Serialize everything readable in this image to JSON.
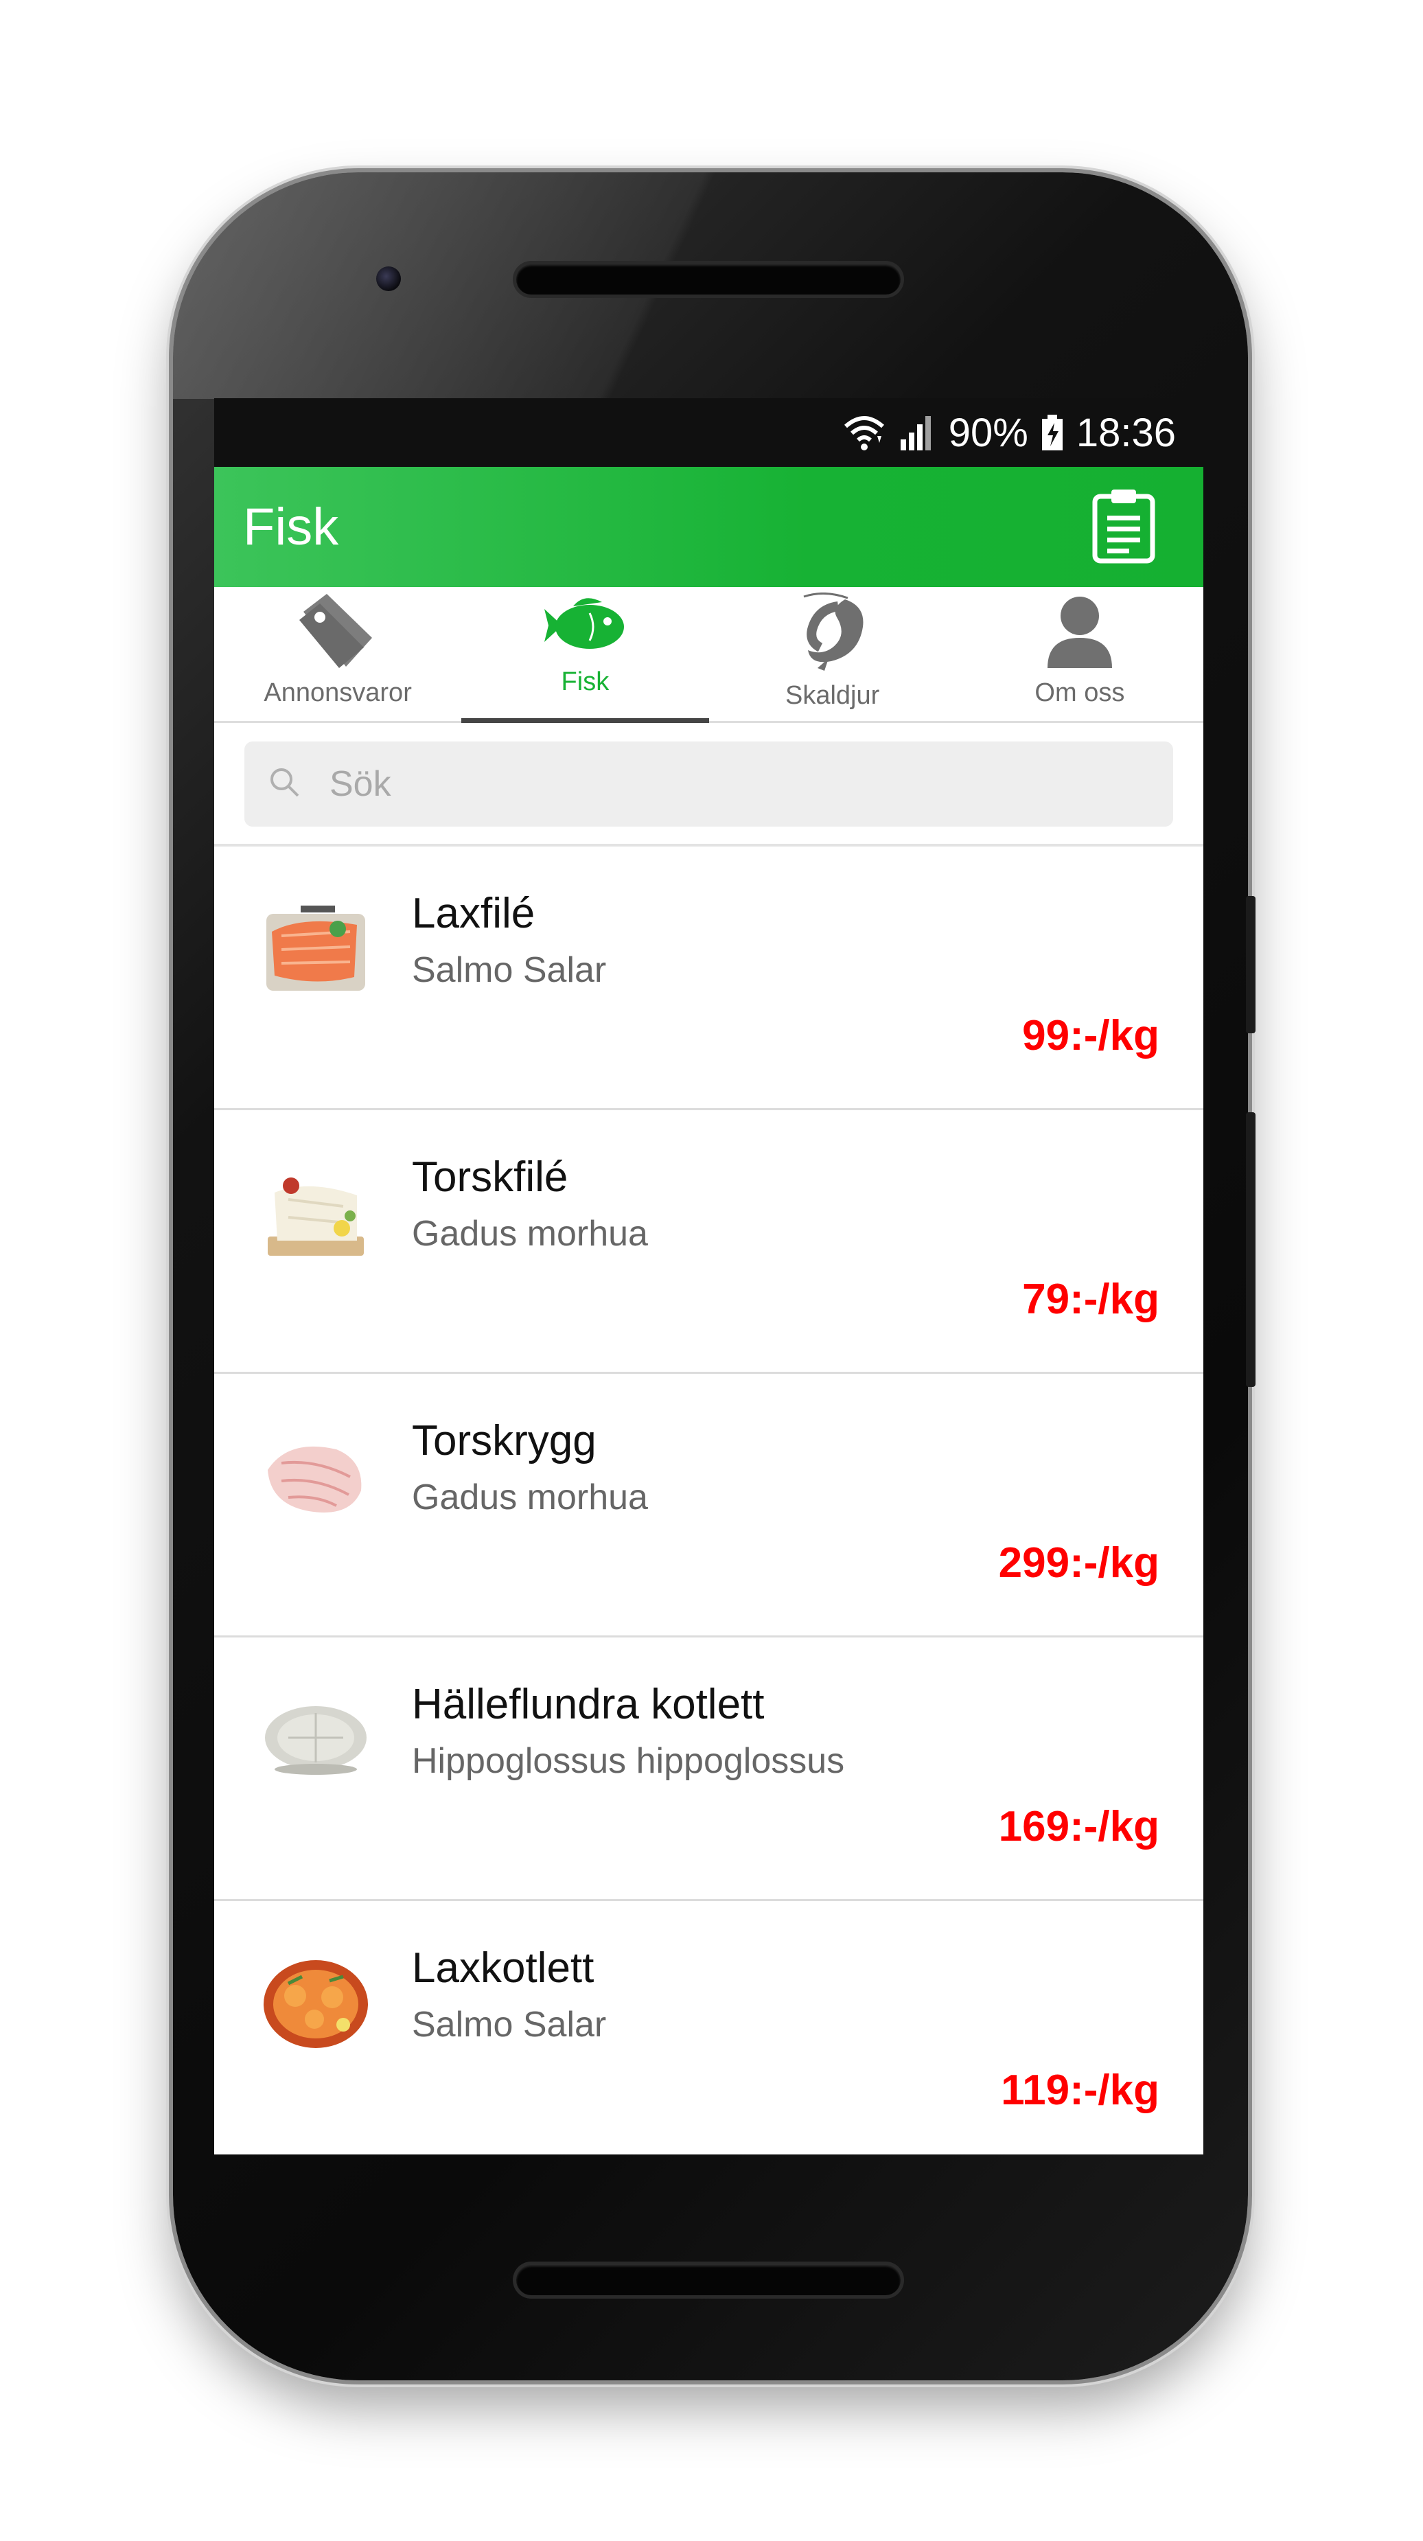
{
  "status_bar": {
    "battery": "90%",
    "time": "18:36",
    "icons": [
      "wifi-icon",
      "signal-icon",
      "battery-charging-icon"
    ]
  },
  "app_bar": {
    "title": "Fisk",
    "action_icon": "clipboard-icon"
  },
  "tabs": [
    {
      "label": "Annonsvaror",
      "icon": "tag-icon",
      "active": false
    },
    {
      "label": "Fisk",
      "icon": "fish-icon",
      "active": true
    },
    {
      "label": "Skaldjur",
      "icon": "shrimp-icon",
      "active": false
    },
    {
      "label": "Om oss",
      "icon": "person-icon",
      "active": false
    }
  ],
  "search": {
    "placeholder": "Sök"
  },
  "products": [
    {
      "name": "Laxfilé",
      "latin": "Salmo Salar",
      "price": "99:-/kg"
    },
    {
      "name": "Torskfilé",
      "latin": "Gadus morhua",
      "price": "79:-/kg"
    },
    {
      "name": "Torskrygg",
      "latin": "Gadus morhua",
      "price": "299:-/kg"
    },
    {
      "name": "Hälleflundra kotlett",
      "latin": "Hippoglossus hippoglossus",
      "price": "169:-/kg"
    },
    {
      "name": "Laxkotlett",
      "latin": "Salmo Salar",
      "price": "119:-/kg"
    }
  ],
  "colors": {
    "accent": "#17b234",
    "price": "#ff0000",
    "status_bar": "#101010"
  }
}
